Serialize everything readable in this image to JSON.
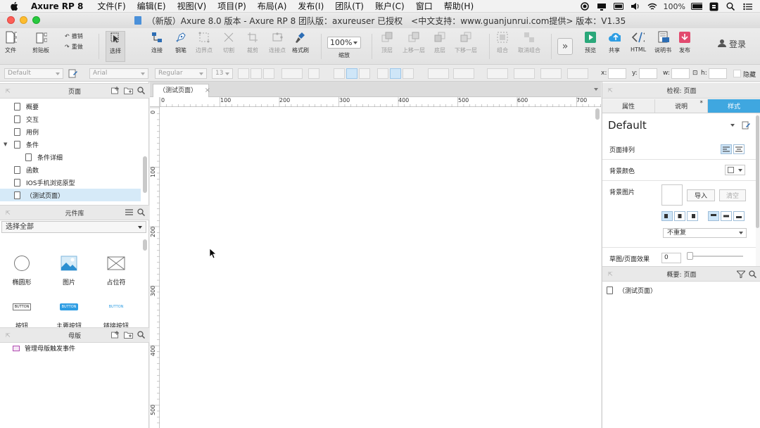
{
  "menubar": {
    "app_name": "Axure RP 8",
    "items": [
      "文件(F)",
      "编辑(E)",
      "视图(V)",
      "项目(P)",
      "布局(A)",
      "发布(I)",
      "团队(T)",
      "账户(C)",
      "窗口",
      "帮助(H)"
    ],
    "battery": "100%"
  },
  "window": {
    "title": "（新版）Axure 8.0 版本 - Axure RP 8 团队版：axureuser 已授权　<中文支持：www.guanjunrui.com提供> 版本：V1.35"
  },
  "toolbar": {
    "file": "文件",
    "clipboard": "剪贴板",
    "undo": "撤销",
    "redo": "重做",
    "select": "选择",
    "connect": "连接",
    "pen": "钢笔",
    "border_point": "边界点",
    "cut": "切割",
    "crop": "裁剪",
    "connect_point": "连接点",
    "format_painter": "格式刷",
    "zoom_value": "100%",
    "zoom_label": "缩放",
    "top": "顶层",
    "up": "上移一层",
    "bottom": "底层",
    "down": "下移一层",
    "group": "组合",
    "ungroup": "取消组合",
    "preview": "预览",
    "share": "共享",
    "html": "HTML",
    "spec": "说明书",
    "publish": "发布",
    "login": "登录"
  },
  "format": {
    "style": "Default",
    "font": "Arial",
    "weight": "Regular",
    "size": "13",
    "x_label": "x:",
    "y_label": "y:",
    "w_label": "w:",
    "h_label": "h:",
    "hide_label": "隐藏"
  },
  "pages": {
    "title": "页面",
    "items": [
      {
        "label": "概要",
        "indent": 0
      },
      {
        "label": "交互",
        "indent": 0
      },
      {
        "label": "用例",
        "indent": 0
      },
      {
        "label": "条件",
        "indent": 0
      },
      {
        "label": "条件详细",
        "indent": 1
      },
      {
        "label": "函数",
        "indent": 0
      },
      {
        "label": "IOS手机浏览原型",
        "indent": 0
      },
      {
        "label": "（测试页面）",
        "indent": 0
      }
    ]
  },
  "library": {
    "title": "元件库",
    "selected": "选择全部",
    "widgets": [
      "椭圆形",
      "图片",
      "占位符",
      "按钮",
      "主要按钮",
      "链接按钮"
    ],
    "button_text": "BUTTON"
  },
  "masters": {
    "title": "母版",
    "items": [
      "管理母版触发事件"
    ]
  },
  "canvas": {
    "tab": "（测试页面）",
    "close": "×",
    "hruler": [
      "0",
      "100",
      "200",
      "300",
      "400",
      "500",
      "600",
      "700"
    ],
    "vruler": [
      "0",
      "100",
      "200",
      "300",
      "400",
      "500"
    ]
  },
  "inspector": {
    "title": "检视: 页面",
    "tabs": [
      "属性",
      "说明",
      "样式"
    ],
    "notes_marker": "*",
    "style_name": "Default",
    "page_align_label": "页面排列",
    "bg_color_label": "背景颜色",
    "bg_image_label": "背景图片",
    "import": "导入",
    "clear": "清空",
    "repeat": "不重复",
    "sketch_label": "草图/页面效果",
    "sketch_value": "0"
  },
  "outline": {
    "title": "概要: 页面",
    "item": "（测试页面）"
  },
  "colors": {
    "accent": "#3fa7e0",
    "selected_row": "#d6eaf8"
  }
}
